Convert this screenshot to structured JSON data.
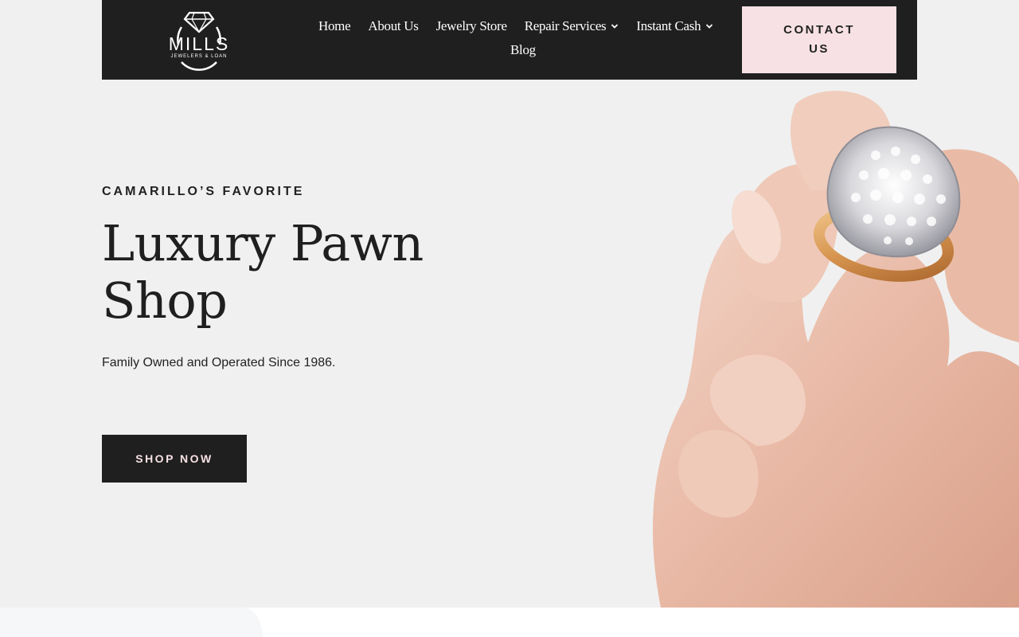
{
  "brand": {
    "name": "MILLS",
    "tagline": "JEWELERS & LOAN"
  },
  "nav": {
    "items": [
      {
        "label": "Home",
        "has_dropdown": false
      },
      {
        "label": "About Us",
        "has_dropdown": false
      },
      {
        "label": "Jewelry Store",
        "has_dropdown": false
      },
      {
        "label": "Repair Services",
        "has_dropdown": true
      },
      {
        "label": "Instant Cash",
        "has_dropdown": true
      },
      {
        "label": "Blog",
        "has_dropdown": false
      }
    ],
    "contact_label": "CONTACT US"
  },
  "hero": {
    "eyebrow": "CAMARILLO’S FAVORITE",
    "title": "Luxury Pawn Shop",
    "subtitle": "Family Owned and Operated Since 1986.",
    "cta_label": "SHOP NOW"
  },
  "colors": {
    "header_bg": "#1f1f1f",
    "page_bg": "#f0f0f0",
    "accent_pink": "#f7e1e4",
    "text_dark": "#222222"
  },
  "icons": {
    "logo": "diamond-ring-icon",
    "dropdown": "chevron-down-icon"
  }
}
